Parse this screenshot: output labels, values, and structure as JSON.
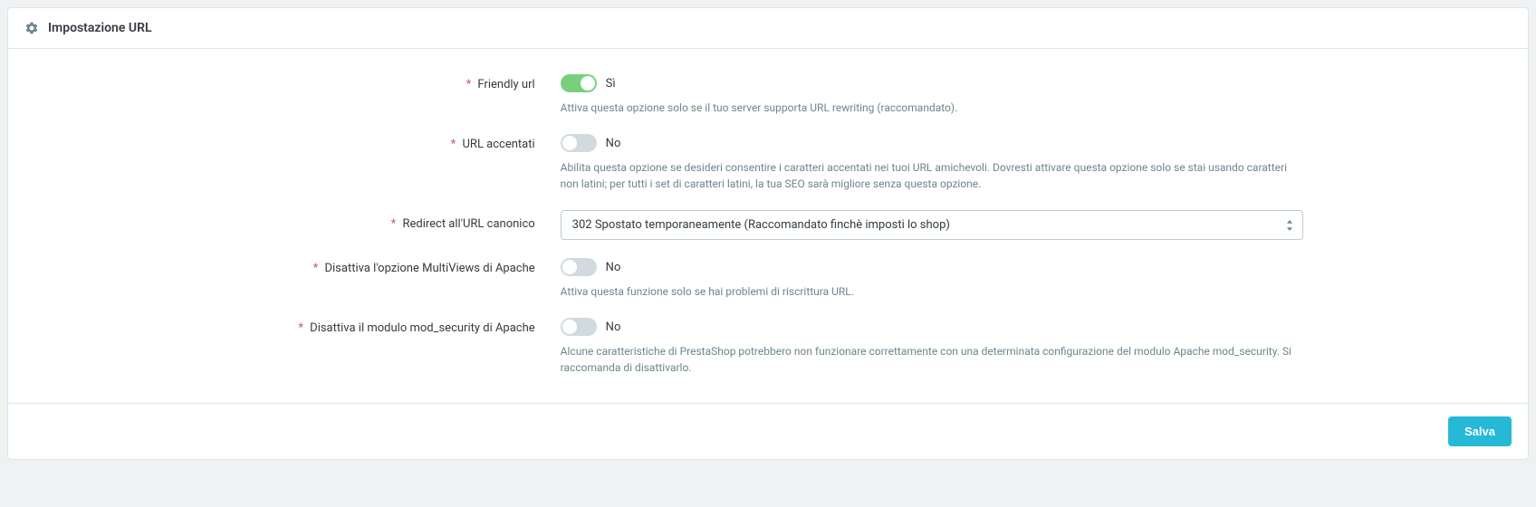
{
  "panel": {
    "title": "Impostazione URL"
  },
  "fields": {
    "friendly_url": {
      "label": "Friendly url",
      "value_label": "Sì",
      "enabled": true,
      "help": "Attiva questa opzione solo se il tuo server supporta URL rewriting (raccomandato)."
    },
    "accented_url": {
      "label": "URL accentati",
      "value_label": "No",
      "enabled": false,
      "help": "Abilita questa opzione se desideri consentire i caratteri accentati nei tuoi URL amichevoli. Dovresti attivare questa opzione solo se stai usando caratteri non latini; per tutti i set di caratteri latini, la tua SEO sarà migliore senza questa opzione."
    },
    "canonical_redirect": {
      "label": "Redirect all'URL canonico",
      "selected": "302 Spostato temporaneamente (Raccomandato finchè imposti lo shop)"
    },
    "multiviews": {
      "label": "Disattiva l'opzione MultiViews di Apache",
      "value_label": "No",
      "enabled": false,
      "help": "Attiva questa funzione solo se hai problemi di riscrittura URL."
    },
    "mod_security": {
      "label": "Disattiva il modulo mod_security di Apache",
      "value_label": "No",
      "enabled": false,
      "help": "Alcune caratteristiche di PrestaShop potrebbero non funzionare correttamente con una determinata configurazione del modulo Apache mod_security. Si raccomanda di disattivarlo."
    }
  },
  "footer": {
    "save_label": "Salva"
  }
}
